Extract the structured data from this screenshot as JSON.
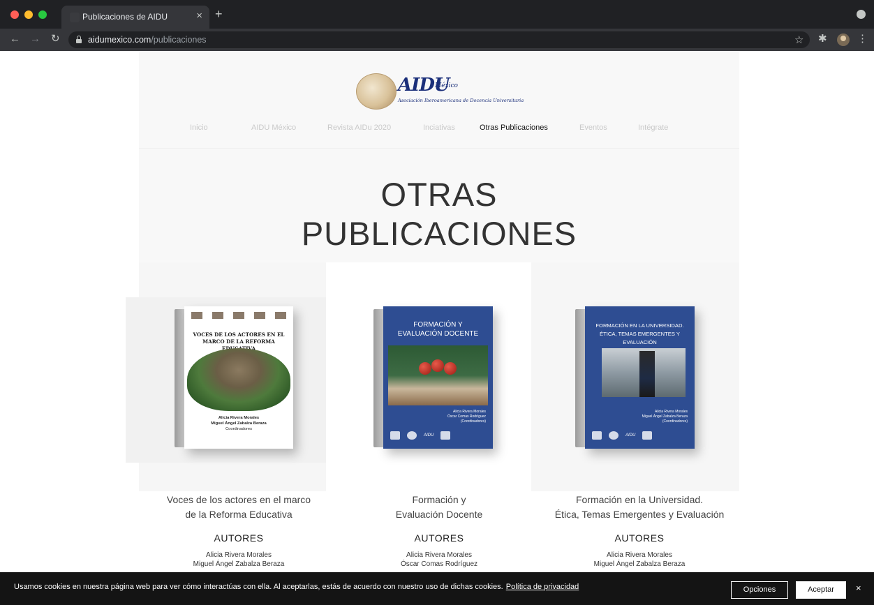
{
  "browser": {
    "tab_title": "Publicaciones de AIDU",
    "tab_close": "×",
    "new_tab": "+",
    "url_host": "aidumexico.com",
    "url_path": "/publicaciones",
    "icons": [
      "back-arrow-icon",
      "forward-arrow-icon",
      "reload-icon",
      "lock-icon",
      "star-icon",
      "puzzle-icon",
      "kebab-menu-icon"
    ]
  },
  "site": {
    "logo_name": "AIDU",
    "logo_country": "México",
    "logo_subtitle": "Asociación Iberoamericana de Docencia Universitaria",
    "nav": [
      {
        "label": "Inicio",
        "active": false
      },
      {
        "label": "AIDU México",
        "active": false
      },
      {
        "label": "Revista AIDu 2020",
        "active": false
      },
      {
        "label": "Inciativas",
        "active": false
      },
      {
        "label": "Otras Publicaciones",
        "active": true
      },
      {
        "label": "Eventos",
        "active": false
      },
      {
        "label": "Intégrate",
        "active": false
      }
    ],
    "hero_line1": "OTRAS",
    "hero_line2": "PUBLICACIONES"
  },
  "publications": [
    {
      "cover_title": "VOCES DE LOS ACTORES EN EL MARCO DE LA REFORMA EDUCATIVA",
      "cover_authors_1": "Alicia Rivera Morales",
      "cover_authors_2": "Miguel Ángel Zabalza Beraza",
      "cover_authors_3": "Coordinadores",
      "title_line1": "Voces de los actores en el marco",
      "title_line2": "de la Reforma Educativa",
      "authors_heading": "AUTORES",
      "author1": "Alicia Rivera Morales",
      "author2": "Miguel Ángel Zabalza Beraza"
    },
    {
      "cover_title_1": "FORMACIÓN Y",
      "cover_title_2": "EVALUACIÓN DOCENTE",
      "cover_authors_1": "Alicia Rivera Morales",
      "cover_authors_2": "Óscar Comas Rodríguez",
      "cover_authors_3": "(Coordinadores)",
      "cover_logo_text": "AIDU",
      "title_line1": "Formación y",
      "title_line2": "Evaluación Docente",
      "authors_heading": "AUTORES",
      "author1": "Alicia Rivera Morales",
      "author2": "Óscar Comas Rodríguez"
    },
    {
      "cover_title_1": "FORMACIÓN EN LA UNIVERSIDAD.",
      "cover_title_2": "ÉTICA, TEMAS EMERGENTES Y EVALUACIÓN",
      "cover_authors_1": "Alicia Rivera Morales",
      "cover_authors_2": "Miguel Ángel Zabalza Beraza",
      "cover_authors_3": "(Coordinadores)",
      "cover_logo_text": "AIDU",
      "title_line1": "Formación en la Universidad.",
      "title_line2": "Ética, Temas Emergentes y Evaluación",
      "authors_heading": "AUTORES",
      "author1": "Alicia Rivera Morales",
      "author2": "Miguel Ángel Zabalza Beraza"
    }
  ],
  "cookie": {
    "message": "Usamos cookies en nuestra página web para ver cómo interactúas con ella. Al aceptarlas, estás de acuerdo con nuestro uso de dichas cookies.",
    "policy_link": "Política de privacidad",
    "options_button": "Opciones",
    "accept_button": "Aceptar",
    "close": "×"
  },
  "colors": {
    "cover_blue": "#2e4d92",
    "logo_blue": "#1b2f7a",
    "cookie_bar": "#141414"
  }
}
